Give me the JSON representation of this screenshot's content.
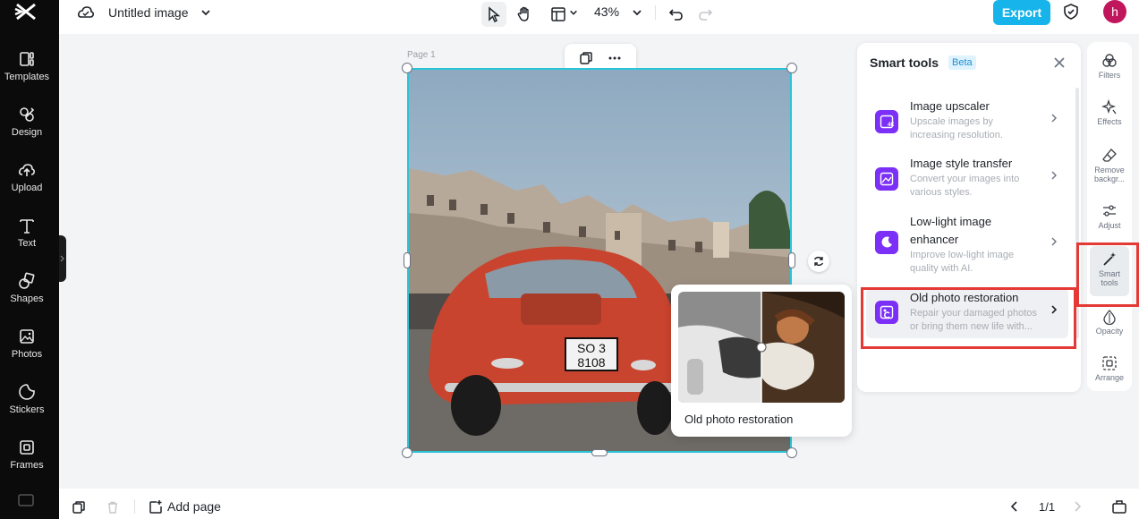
{
  "sidebar": {
    "items": [
      {
        "label": "Templates",
        "icon": "templates-icon"
      },
      {
        "label": "Design",
        "icon": "design-icon"
      },
      {
        "label": "Upload",
        "icon": "upload-icon"
      },
      {
        "label": "Text",
        "icon": "text-icon"
      },
      {
        "label": "Shapes",
        "icon": "shapes-icon"
      },
      {
        "label": "Photos",
        "icon": "photos-icon"
      },
      {
        "label": "Stickers",
        "icon": "stickers-icon"
      },
      {
        "label": "Frames",
        "icon": "frames-icon"
      }
    ]
  },
  "header": {
    "title": "Untitled image",
    "zoom": "43%",
    "export_label": "Export",
    "avatar_initial": "h"
  },
  "canvas": {
    "page_label": "Page 1"
  },
  "preview": {
    "label": "Old photo restoration"
  },
  "smart_tools": {
    "title": "Smart tools",
    "badge": "Beta",
    "tools": [
      {
        "name": "Image upscaler",
        "desc_line1": "Upscale images by",
        "desc_line2": "increasing resolution."
      },
      {
        "name": "Image style transfer",
        "desc_line1": "Convert your images into",
        "desc_line2": "various styles."
      },
      {
        "name_line1": "Low-light image",
        "name_line2": "enhancer",
        "desc_line1": "Improve low-light image",
        "desc_line2": "quality with AI."
      },
      {
        "name": "Old photo restoration",
        "desc_line1": "Repair your damaged photos",
        "desc_line2": "or bring them new life with..."
      }
    ]
  },
  "rail": {
    "items": [
      {
        "label": "Filters"
      },
      {
        "label": "Effects"
      },
      {
        "label_line1": "Remove",
        "label_line2": "backgr..."
      },
      {
        "label": "Adjust"
      },
      {
        "label_line1": "Smart",
        "label_line2": "tools"
      },
      {
        "label": "Opacity"
      },
      {
        "label": "Arrange"
      }
    ]
  },
  "footer": {
    "add_page_label": "Add page",
    "pager": "1/1"
  },
  "colors": {
    "accent": "#16b4ea",
    "tool_icon": "#7b2ff7",
    "highlight": "#e53935",
    "selection": "#2cc3d8"
  }
}
